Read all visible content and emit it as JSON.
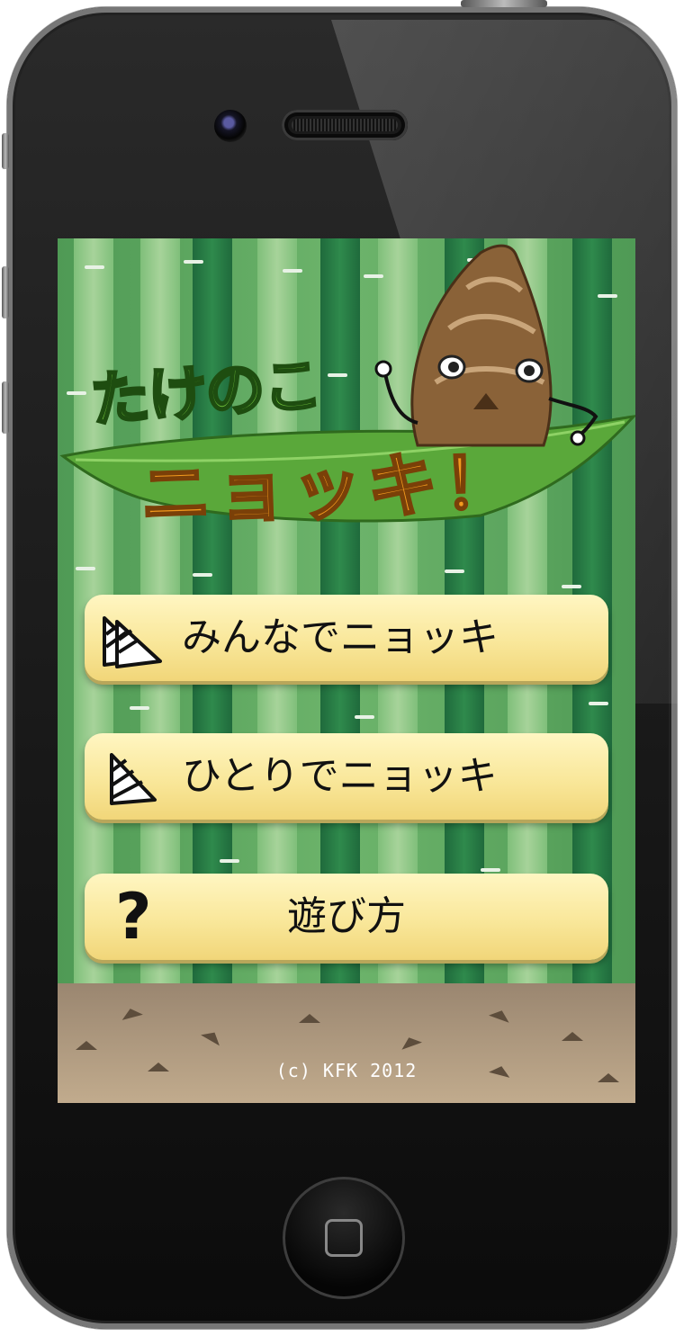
{
  "app": {
    "title_top": "たけのこ",
    "title_main": "ニョッキ！"
  },
  "menu": {
    "items": [
      {
        "label": "みんなでニョッキ",
        "icon": "double-bamboo-shoot-icon"
      },
      {
        "label": "ひとりでニョッキ",
        "icon": "bamboo-shoot-icon"
      },
      {
        "label": "遊び方",
        "icon": "question-mark-icon",
        "glyph": "?"
      }
    ]
  },
  "footer": {
    "copyright": "(c) KFK 2012"
  },
  "colors": {
    "button_fill": "#f9e79a",
    "title_orange": "#f39a1e",
    "title_green": "#6fbf3a",
    "bamboo_dark": "#2f8a4c",
    "bamboo_light": "#a7d39a",
    "ground": "#b39c7e"
  }
}
